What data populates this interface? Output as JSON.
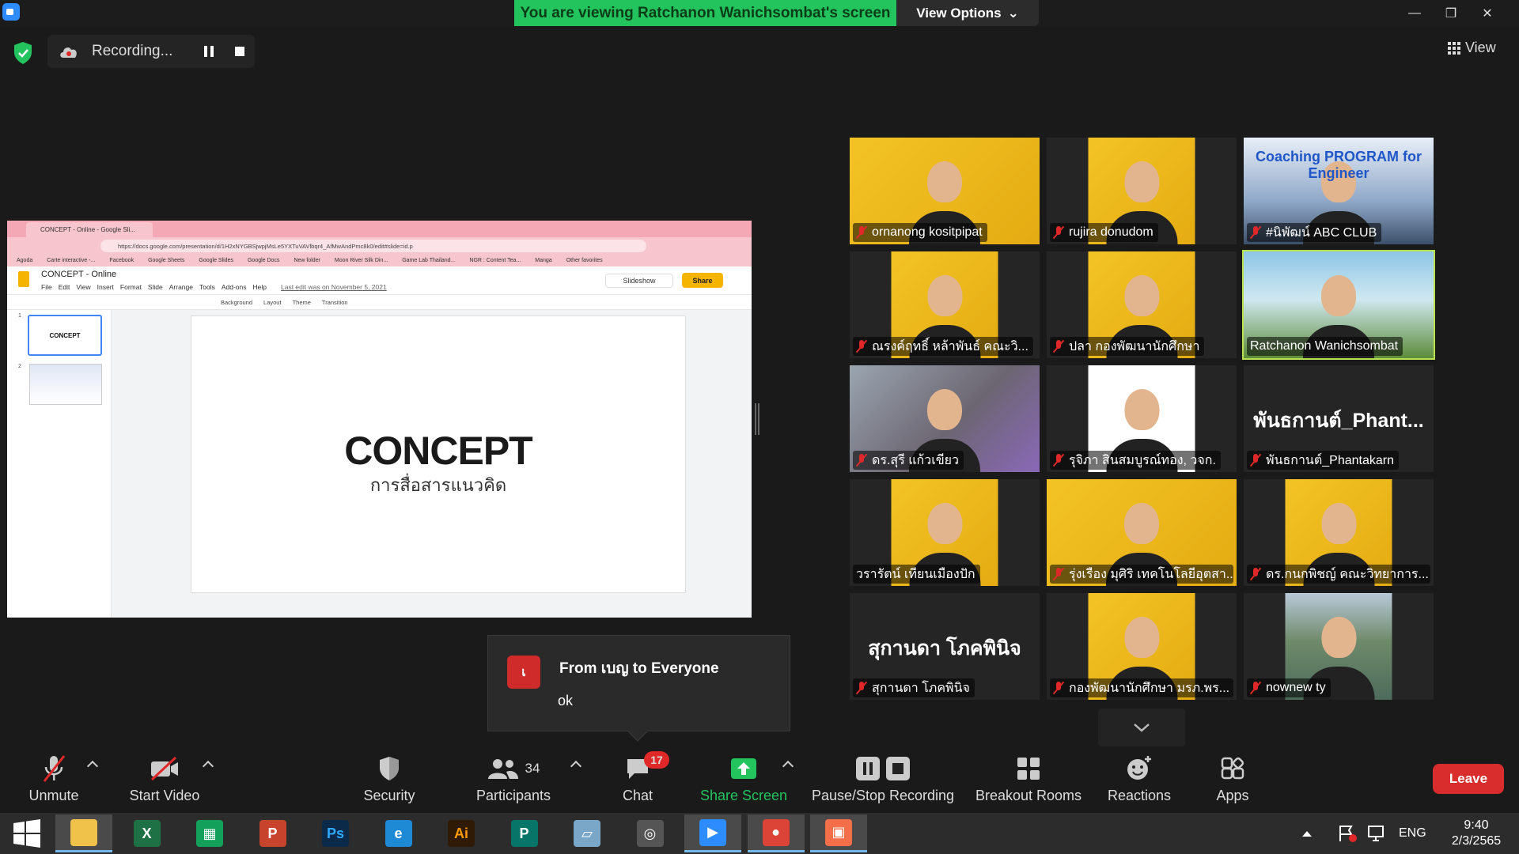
{
  "window": {
    "viewing_banner": "You are viewing Ratchanon Wanichsombat's screen",
    "view_options": "View Options"
  },
  "topbar": {
    "recording_label": "Recording...",
    "view_label": "View"
  },
  "shared_screen": {
    "tab_title": "CONCEPT - Online - Google Sli...",
    "url": "https://docs.google.com/presentation/d/1H2xNYGBSjwpjMsLe5YXTuVAVlbqr4_AfMwAndPmc8k0/edit#slide=id.p",
    "bookmarks": [
      "Agoda",
      "Carte interactive -...",
      "Facebook",
      "Google Sheets",
      "Google Slides",
      "Google Docs",
      "New folder",
      "Moon River Silk Din...",
      "Game Lab Thailand...",
      "NGR : Content Tea...",
      "Manga",
      "Other favorites"
    ],
    "doc_title": "CONCEPT - Online",
    "menu": [
      "File",
      "Edit",
      "View",
      "Insert",
      "Format",
      "Slide",
      "Arrange",
      "Tools",
      "Add-ons",
      "Help"
    ],
    "last_edit": "Last edit was on November 5, 2021",
    "slideshow_label": "Slideshow",
    "share_label": "Share",
    "toolbar_items": [
      "Background",
      "Layout",
      "Theme",
      "Transition"
    ],
    "slide_numbers": [
      "1",
      "2"
    ],
    "thumb1_text": "CONCEPT",
    "slide_title": "CONCEPT",
    "slide_subtitle": "การสื่อสารแนวคิด"
  },
  "participants_grid": [
    {
      "name": "ornanong kositpipat",
      "muted": true
    },
    {
      "name": "rujira donudom",
      "muted": true
    },
    {
      "name": "#นิพัฒน์ ABC CLUB",
      "muted": true,
      "video_text": "Coaching PROGRAM for Engineer"
    },
    {
      "name": "ณรงค์ฤทธิ์ หล้าพันธ์ คณะวิ...",
      "muted": true
    },
    {
      "name": "ปลา กองพัฒนานักศึกษา",
      "muted": true
    },
    {
      "name": "Ratchanon Wanichsombat",
      "muted": false
    },
    {
      "name": "ดร.สุรี แก้วเขียว",
      "muted": true
    },
    {
      "name": "รุจิภา สินสมบูรณ์ทอง, วจก.",
      "muted": true
    },
    {
      "name": "พันธกานต์_Phantakarn",
      "muted": true,
      "big_name": "พันธกานต์_Phant..."
    },
    {
      "name": "วรารัตน์ เทียนเมืองปัก",
      "muted": false
    },
    {
      "name": "รุ่งเรือง มุศิริ เทคโนโลยีอุตสา...",
      "muted": true
    },
    {
      "name": "ดร.กนกพิชญ์ คณะวิทยาการ...",
      "muted": true
    },
    {
      "name": "สุกานดา โภคพินิจ",
      "muted": true,
      "big_name": "สุกานดา โภคพินิจ"
    },
    {
      "name": "กองพัฒนานักศึกษา มรภ.พร...",
      "muted": true
    },
    {
      "name": "nownew ty",
      "muted": true
    }
  ],
  "chat_popup": {
    "avatar_letter": "เ",
    "from": "From เบญ to Everyone",
    "message": "ok"
  },
  "toolbar": {
    "unmute": "Unmute",
    "start_video": "Start Video",
    "security": "Security",
    "participants": "Participants",
    "participants_count": "34",
    "chat": "Chat",
    "chat_badge": "17",
    "share_screen": "Share Screen",
    "pause_recording": "Pause/Stop Recording",
    "breakout_rooms": "Breakout Rooms",
    "reactions": "Reactions",
    "apps": "Apps",
    "leave": "Leave"
  },
  "taskbar": {
    "apps": [
      "file-explorer",
      "excel",
      "sheets-app",
      "powerpoint",
      "photoshop",
      "internet-explorer",
      "illustrator",
      "publisher",
      "notes-app",
      "photoscape",
      "zoom",
      "chrome",
      "pic-app"
    ],
    "lang": "ENG",
    "time": "9:40",
    "date": "2/3/2565"
  },
  "colors": {
    "banner_green": "#23c45e",
    "share_green": "#23c45e",
    "leave_red": "#d92d2d",
    "mute_red": "#e02828",
    "active_speaker": "#b7e14f"
  }
}
